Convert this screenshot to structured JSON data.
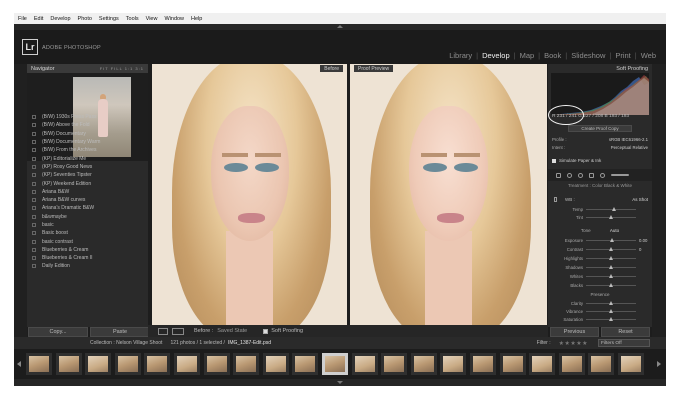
{
  "menubar": [
    "File",
    "Edit",
    "Develop",
    "Photo",
    "Settings",
    "Tools",
    "View",
    "Window",
    "Help"
  ],
  "identity": {
    "logo": "Lr",
    "brand": "ADOBE PHOTOSHOP"
  },
  "modules": [
    {
      "label": "Library",
      "active": false
    },
    {
      "label": "Develop",
      "active": true
    },
    {
      "label": "Map",
      "active": false
    },
    {
      "label": "Book",
      "active": false
    },
    {
      "label": "Slideshow",
      "active": false
    },
    {
      "label": "Print",
      "active": false
    },
    {
      "label": "Web",
      "active": false
    }
  ],
  "navigator": {
    "title": "Navigator",
    "zoom": "FIT FILL 1:1 3:1"
  },
  "presets": [
    "(B/W) 1930s Press Pass",
    "(B/W) Above the Fold",
    "(B/W) Documentary",
    "(B/W) Documentary Warm",
    "(B/W) From the Archives",
    "(KP) Editorialize Me",
    "(KP) Rosy Good News",
    "(KP) Seventies Tipster",
    "(KP) Weekend Edition",
    "Ariana B&W",
    "Ariana B&W curves",
    "Ariana's Dramatic B&W",
    "b&wmaybe",
    "basic",
    "Basic boost",
    "basic contrast",
    "Blueberries & Cream",
    "Blueberries & Cream II",
    "Daily Edition"
  ],
  "left_buttons": {
    "copy": "Copy...",
    "paste": "Paste"
  },
  "views": {
    "before_tag": "Before",
    "after_tag": "Proof Preview"
  },
  "toolbar": {
    "before_label": "Before :",
    "state": "Saved State",
    "soft_proofing": "Soft Proofing"
  },
  "right_panel": {
    "title": "Soft Proofing",
    "rgb_readout": "R  231 / 241  G  227 / 208  B  193 / 193",
    "create_proof": "Create Proof Copy",
    "profile_label": "Profile :",
    "profile_value": "sRGB IEC61966-2.1",
    "intent_label": "Intent :",
    "intent_value": "Perceptual   Relative",
    "simulate": "Simulate Paper & Ink",
    "basic_tabs": "Treatment :   Color   Black & White",
    "wb_label": "WB :",
    "wb_value": "As Shot",
    "tone_label": "Tone",
    "tone_auto": "Auto",
    "presence_label": "Presence",
    "sliders_wb": [
      {
        "name": "Temp",
        "pos": 0.55,
        "value": ""
      },
      {
        "name": "Tint",
        "pos": 0.5,
        "value": ""
      }
    ],
    "sliders_tone": [
      {
        "name": "Exposure",
        "pos": 0.52,
        "value": "0.00"
      },
      {
        "name": "Contrast",
        "pos": 0.5,
        "value": "0"
      },
      {
        "name": "Highlights",
        "pos": 0.5,
        "value": ""
      },
      {
        "name": "Shadows",
        "pos": 0.5,
        "value": ""
      },
      {
        "name": "Whites",
        "pos": 0.5,
        "value": ""
      },
      {
        "name": "Blacks",
        "pos": 0.5,
        "value": ""
      }
    ],
    "sliders_presence": [
      {
        "name": "Clarity",
        "pos": 0.5,
        "value": ""
      },
      {
        "name": "Vibrance",
        "pos": 0.5,
        "value": ""
      },
      {
        "name": "Saturation",
        "pos": 0.5,
        "value": ""
      }
    ],
    "previous": "Previous",
    "reset": "Reset"
  },
  "filmstrip_bar": {
    "collection": "Collection : Nelson Village Shoot",
    "count": "121 photos / 1 selected /",
    "filename": "IMG_1387-Edit.psd",
    "filter_label": "Filter :",
    "filter_value": "Filters Off"
  },
  "thumbnails": 21,
  "selected_thumb": 10
}
